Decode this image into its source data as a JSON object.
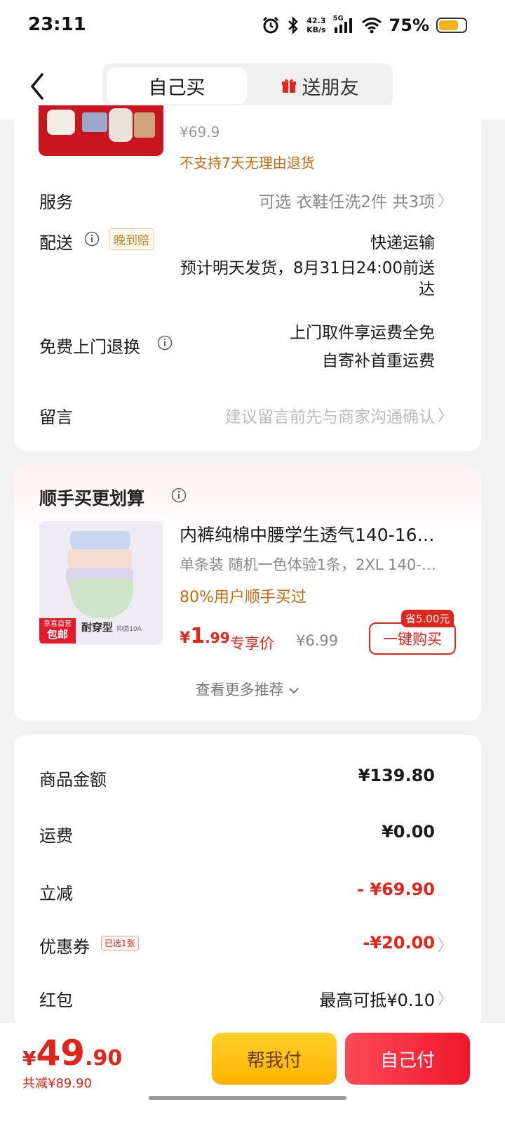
{
  "status_bar": {
    "time": "23:11",
    "net_speed_value": "42.3",
    "net_speed_unit": "KB/s",
    "signal_label": "5G",
    "battery_percent": "75%",
    "battery_level": 0.75
  },
  "header": {
    "tab_self": "自己买",
    "tab_gift": "送朋友"
  },
  "product": {
    "original_price": "¥69.9",
    "return_note": "不支持7天无理由退货"
  },
  "service": {
    "label": "服务",
    "value": "可选 衣鞋任洗2件 共3项"
  },
  "delivery": {
    "label": "配送",
    "badge": "晚到赔",
    "method": "快递运输",
    "estimate_line1": "预计明天发货，8月31日24:00前送",
    "estimate_line2": "达"
  },
  "free_return": {
    "label": "免费上门退换",
    "line1": "上门取件享运费全免",
    "line2": "自寄补首重运费"
  },
  "message": {
    "label": "留言",
    "placeholder": "建议留言前先与商家沟通确认"
  },
  "recommend": {
    "title": "顺手买更划算",
    "image_tag_small": "京喜自营",
    "image_tag_big": "包邮",
    "image_caption": "耐穿型",
    "image_caption_small": "抑菌10A",
    "name": "内裤纯棉中腰学生透气140-16…",
    "spec": "单条装 随机一色体验1条，2XL 140-…",
    "users_note": "80%用户顺手买过",
    "price_currency": "¥",
    "price_int": "1",
    "price_dec": ".99",
    "exclusive_label": "专享价",
    "original_price": "¥6.99",
    "save_tag": "省5.00元",
    "buy_button": "一键购买",
    "more": "查看更多推荐"
  },
  "totals": {
    "goods_label": "商品金额",
    "goods_value": "¥139.80",
    "shipping_label": "运费",
    "shipping_value": "¥0.00",
    "discount_label": "立减",
    "discount_value": "- ¥69.90",
    "coupon_label": "优惠券",
    "coupon_badge": "已选1张",
    "coupon_value": "-¥20.00",
    "redpacket_label": "红包",
    "redpacket_value": "最高可抵¥0.10"
  },
  "bottom": {
    "currency": "¥",
    "total_int": "49",
    "total_dec": ".90",
    "saved": "共减¥89.90",
    "help_pay": "帮我付",
    "self_pay": "自己付"
  },
  "colors": {
    "accent_red": "#e1251b",
    "orange_note": "#c56b15",
    "help_pay_yellow": "#ffc107"
  }
}
